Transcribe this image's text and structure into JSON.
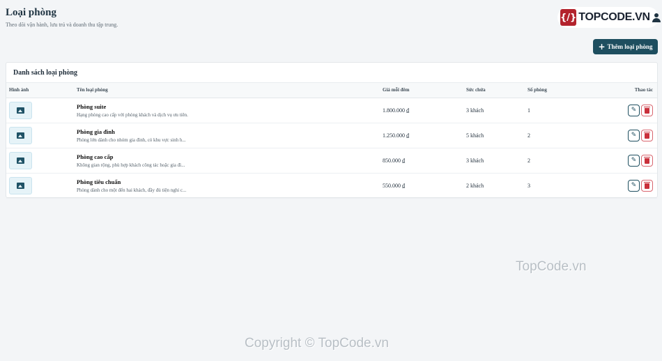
{
  "header": {
    "title": "Loại phòng",
    "subtitle": "Theo dõi vận hành, lưu trú và doanh thu tập trung."
  },
  "brand": {
    "logo_glyph": "{/}",
    "name": "TOPCODE.VN",
    "logo_color": "#b3232d"
  },
  "toolbar": {
    "add_label": "Thêm loại phòng",
    "add_icon": "+"
  },
  "list": {
    "title": "Danh sách loại phòng",
    "columns": [
      "Hình ảnh",
      "Tên loại phòng",
      "Giá mỗi đêm",
      "Sức chứa",
      "Số phòng",
      "Thao tác"
    ],
    "rows": [
      {
        "name": "Phòng suite",
        "description": "Hạng phòng cao cấp với phòng khách và dịch vụ ưu tiên.",
        "price": "1.800.000 ₫",
        "capacity": "3 khách",
        "rooms": "1"
      },
      {
        "name": "Phòng gia đình",
        "description": "Phòng lớn dành cho nhóm gia đình, có khu vực sinh h...",
        "price": "1.250.000 ₫",
        "capacity": "5 khách",
        "rooms": "2"
      },
      {
        "name": "Phòng cao cấp",
        "description": "Không gian rộng, phù hợp khách công tác hoặc gia đì...",
        "price": "850.000 ₫",
        "capacity": "3 khách",
        "rooms": "2"
      },
      {
        "name": "Phòng tiêu chuẩn",
        "description": "Phòng dành cho một đến hai khách, đầy đủ tiện nghi c...",
        "price": "550.000 ₫",
        "capacity": "2 khách",
        "rooms": "3"
      }
    ]
  },
  "watermarks": {
    "small": "TopCode.vn",
    "copyright": "Copyright © TopCode.vn"
  },
  "colors": {
    "primary": "#1e4e5f",
    "danger": "#c9303b",
    "background": "#f3f5f7"
  }
}
